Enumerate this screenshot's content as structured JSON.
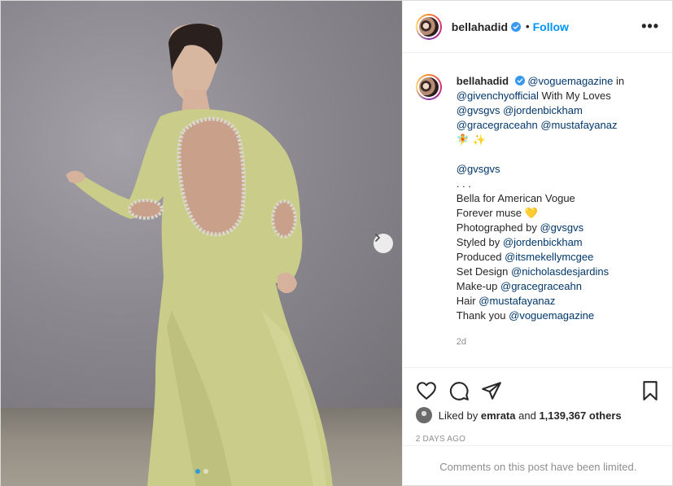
{
  "header": {
    "username": "bellahadid",
    "separator": "•",
    "follow_label": "Follow",
    "more_label": "•••"
  },
  "caption": {
    "username": "bellahadid",
    "lines": [
      {
        "type": "mixed",
        "parts": [
          {
            "t": "mention",
            "v": "@voguemagazine"
          },
          {
            "t": "text",
            "v": " in"
          }
        ]
      },
      {
        "type": "mixed",
        "parts": [
          {
            "t": "mention",
            "v": "@givenchyofficial"
          },
          {
            "t": "text",
            "v": " With My Loves"
          }
        ]
      },
      {
        "type": "mixed",
        "parts": [
          {
            "t": "mention",
            "v": "@gvsgvs"
          },
          {
            "t": "text",
            "v": " "
          },
          {
            "t": "mention",
            "v": "@jordenbickham"
          }
        ]
      },
      {
        "type": "mixed",
        "parts": [
          {
            "t": "mention",
            "v": "@gracegraceahn"
          },
          {
            "t": "text",
            "v": " "
          },
          {
            "t": "mention",
            "v": "@mustafayanaz"
          }
        ]
      },
      {
        "type": "mixed",
        "parts": [
          {
            "t": "text",
            "v": "🧚 ✨"
          }
        ]
      },
      {
        "type": "mixed",
        "parts": [
          {
            "t": "text",
            "v": " "
          }
        ]
      },
      {
        "type": "mixed",
        "parts": [
          {
            "t": "mention",
            "v": "@gvsgvs"
          }
        ]
      },
      {
        "type": "mixed",
        "parts": [
          {
            "t": "text",
            "v": ".  .  ."
          }
        ]
      },
      {
        "type": "mixed",
        "parts": [
          {
            "t": "text",
            "v": "Bella for American Vogue"
          }
        ]
      },
      {
        "type": "mixed",
        "parts": [
          {
            "t": "text",
            "v": "Forever muse 💛"
          }
        ]
      },
      {
        "type": "mixed",
        "parts": [
          {
            "t": "text",
            "v": "Photographed by "
          },
          {
            "t": "mention",
            "v": "@gvsgvs"
          }
        ]
      },
      {
        "type": "mixed",
        "parts": [
          {
            "t": "text",
            "v": "Styled by "
          },
          {
            "t": "mention",
            "v": "@jordenbickham"
          }
        ]
      },
      {
        "type": "mixed",
        "parts": [
          {
            "t": "text",
            "v": "Produced "
          },
          {
            "t": "mention",
            "v": "@itsmekellymcgee"
          }
        ]
      },
      {
        "type": "mixed",
        "parts": [
          {
            "t": "text",
            "v": "Set Design "
          },
          {
            "t": "mention",
            "v": "@nicholasdesjardins"
          }
        ]
      },
      {
        "type": "mixed",
        "parts": [
          {
            "t": "text",
            "v": "Make-up "
          },
          {
            "t": "mention",
            "v": "@gracegraceahn"
          }
        ]
      },
      {
        "type": "mixed",
        "parts": [
          {
            "t": "text",
            "v": "Hair "
          },
          {
            "t": "mention",
            "v": "@mustafayanaz"
          }
        ]
      },
      {
        "type": "mixed",
        "parts": [
          {
            "t": "text",
            "v": "Thank you "
          },
          {
            "t": "mention",
            "v": "@voguemagazine"
          }
        ]
      }
    ],
    "time_ago": "2d"
  },
  "actions": {
    "icons": [
      "heart-icon",
      "comment-icon",
      "share-icon",
      "bookmark-icon"
    ],
    "liked_by_prefix": "Liked by",
    "liked_by_user": "emrata",
    "liked_by_and": "and",
    "liked_by_count": "1,139,367 others",
    "date": "2 DAYS AGO"
  },
  "comments": {
    "limited_text": "Comments on this post have been limited."
  },
  "media": {
    "carousel_total": 2,
    "carousel_index": 1
  },
  "colors": {
    "link": "#00376b",
    "follow": "#0095f6",
    "verified": "#3897f0",
    "dress": "#c9cd89"
  }
}
